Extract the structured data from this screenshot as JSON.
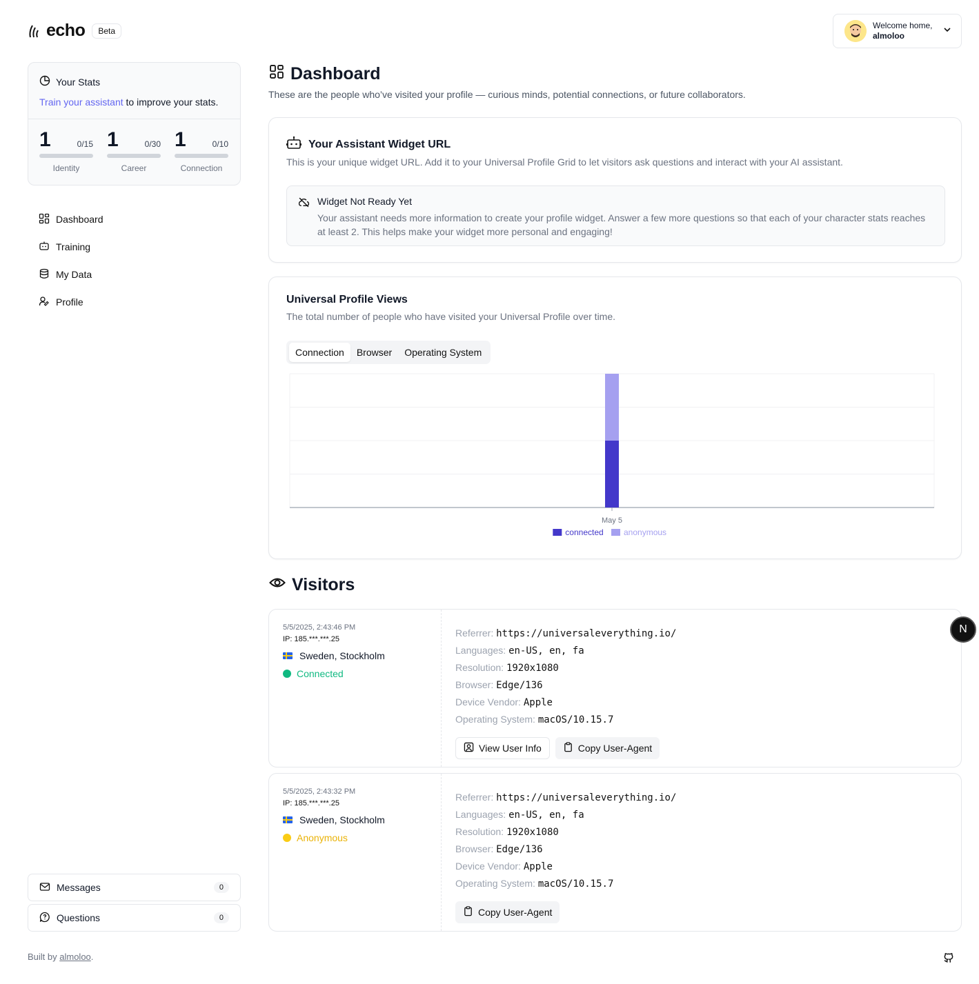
{
  "brand": {
    "name": "echo",
    "badge": "Beta"
  },
  "user": {
    "greeting": "Welcome home,",
    "name": "almoloo"
  },
  "stats": {
    "title": "Your Stats",
    "link_text": "Train your assistant",
    "subtitle_rest": " to improve your stats.",
    "items": [
      {
        "value": "1",
        "max": "0/15",
        "label": "Identity"
      },
      {
        "value": "1",
        "max": "0/30",
        "label": "Career"
      },
      {
        "value": "1",
        "max": "0/10",
        "label": "Connection"
      }
    ]
  },
  "nav": [
    {
      "label": "Dashboard",
      "icon": "dashboard-icon"
    },
    {
      "label": "Training",
      "icon": "training-icon"
    },
    {
      "label": "My Data",
      "icon": "database-icon"
    },
    {
      "label": "Profile",
      "icon": "profile-icon"
    }
  ],
  "sidebar_buttons": {
    "messages": {
      "label": "Messages",
      "count": "0"
    },
    "questions": {
      "label": "Questions",
      "count": "0"
    }
  },
  "footer": {
    "prefix": "Built by ",
    "link": "almoloo",
    "suffix": "."
  },
  "page": {
    "title": "Dashboard",
    "description": "These are the people who’ve visited your profile — curious minds, potential connections, or future collaborators."
  },
  "widget": {
    "title": "Your Assistant Widget URL",
    "description": "This is your unique widget URL. Add it to your Universal Profile Grid to let visitors ask questions and interact with your AI assistant.",
    "notice_title": "Widget Not Ready Yet",
    "notice_text": "Your assistant needs more information to create your profile widget. Answer a few more questions so that each of your character stats reaches at least 2. This helps make your widget more personal and engaging!"
  },
  "views": {
    "title": "Universal Profile Views",
    "description": "The total number of people who have visited your Universal Profile over time.",
    "tabs": [
      "Connection",
      "Browser",
      "Operating System"
    ],
    "active_tab": 0
  },
  "chart_data": {
    "type": "bar",
    "stacked": true,
    "categories": [
      "May 5"
    ],
    "series": [
      {
        "name": "connected",
        "values": [
          1
        ],
        "color": "#4338ca"
      },
      {
        "name": "anonymous",
        "values": [
          1
        ],
        "color": "#a5a0f0"
      }
    ],
    "ylim": [
      0,
      2
    ],
    "grid": true,
    "legend": "bottom"
  },
  "visitors": {
    "title": "Visitors",
    "list": [
      {
        "time": "5/5/2025, 2:43:46 PM",
        "ip": "IP: 185.***.***.25",
        "location": "Sweden, Stockholm",
        "status": "Connected",
        "status_color": "#10b981",
        "referrer": "https://universaleverything.io/",
        "languages": "en-US, en, fa",
        "resolution": "1920x1080",
        "browser": "Edge/136",
        "vendor": "Apple",
        "os": "macOS/10.15.7",
        "view_btn": "View User Info",
        "copy_btn": "Copy User-Agent"
      },
      {
        "time": "5/5/2025, 2:43:32 PM",
        "ip": "IP: 185.***.***.25",
        "location": "Sweden, Stockholm",
        "status": "Anonymous",
        "status_color": "#eab308",
        "referrer": "https://universaleverything.io/",
        "languages": "en-US, en, fa",
        "resolution": "1920x1080",
        "browser": "Edge/136",
        "vendor": "Apple",
        "os": "macOS/10.15.7",
        "copy_btn": "Copy User-Agent"
      }
    ],
    "labels": {
      "referrer": "Referrer:",
      "languages": "Languages:",
      "resolution": "Resolution:",
      "browser": "Browser:",
      "vendor": "Device Vendor:",
      "os": "Operating System:"
    }
  },
  "floating_badge": "N"
}
